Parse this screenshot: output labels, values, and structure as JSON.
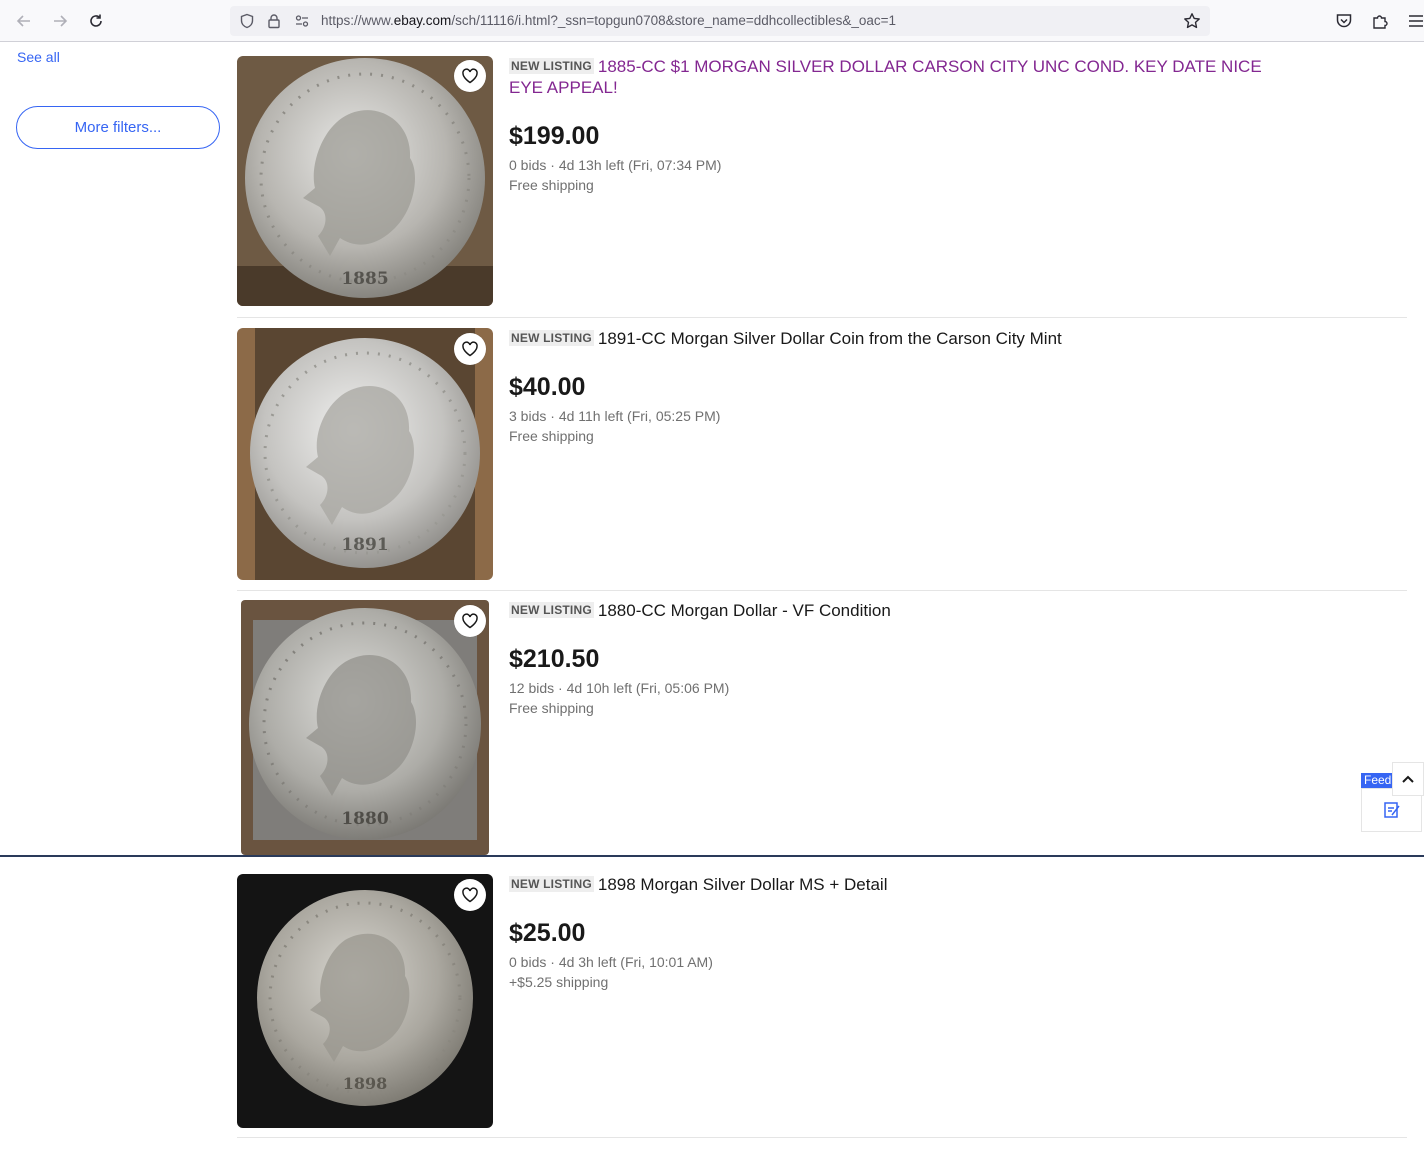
{
  "browser": {
    "url_prefix": "https://www.",
    "url_domain": "ebay.com",
    "url_rest": "/sch/11116/i.html?_ssn=topgun0708&store_name=ddhcollectibles&_oac=1"
  },
  "sidebar": {
    "see_all": "See all",
    "more_filters": "More filters..."
  },
  "listings": [
    {
      "badge": "NEW LISTING",
      "title": "1885-CC $1 MORGAN SILVER DOLLAR CARSON CITY UNC COND. KEY DATE NICE EYE APPEAL!",
      "price": "$199.00",
      "bids": "0 bids",
      "time_left": "4d 13h left (Fri, 07:34 PM)",
      "shipping": "Free shipping",
      "coin_year": "1885"
    },
    {
      "badge": "NEW LISTING",
      "title": "1891-CC Morgan Silver Dollar Coin from the Carson City Mint",
      "price": "$40.00",
      "bids": "3 bids",
      "time_left": "4d 11h left (Fri, 05:25 PM)",
      "shipping": "Free shipping",
      "coin_year": "1891"
    },
    {
      "badge": "NEW LISTING",
      "title": "1880-CC Morgan Dollar - VF Condition",
      "price": "$210.50",
      "bids": "12 bids",
      "time_left": "4d 10h left (Fri, 05:06 PM)",
      "shipping": "Free shipping",
      "coin_year": "1880"
    },
    {
      "badge": "NEW LISTING",
      "title": "1898 Morgan Silver Dollar MS + Detail",
      "price": "$25.00",
      "bids": "0 bids",
      "time_left": "4d 3h left (Fri, 10:01 AM)",
      "shipping": "+$5.25 shipping",
      "coin_year": "1898"
    }
  ],
  "feedback": {
    "label": "Feed"
  },
  "colors": {
    "link": "#3665f3",
    "visited": "#832791"
  }
}
